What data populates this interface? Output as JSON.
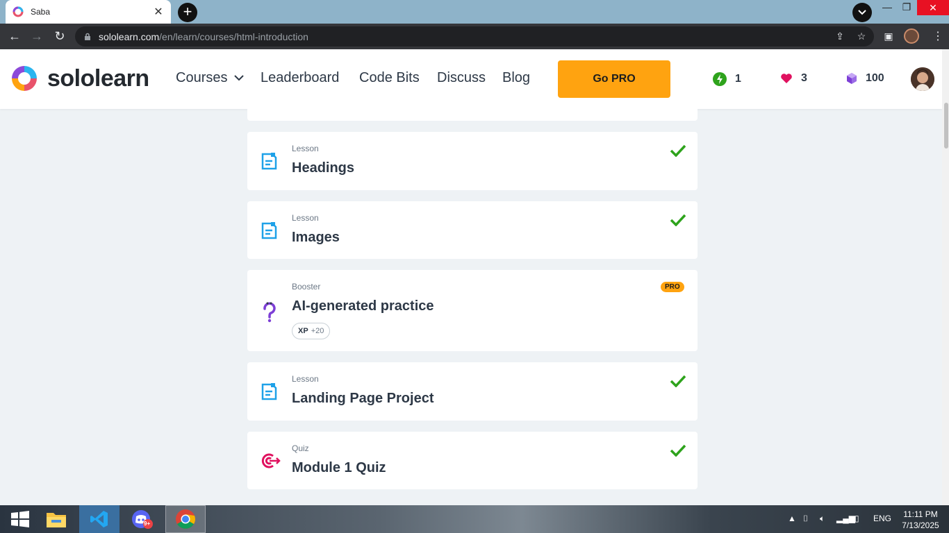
{
  "browser": {
    "tab_title": "Saba",
    "new_tab": "+",
    "url_host": "sololearn.com",
    "url_path": "/en/learn/courses/html-introduction"
  },
  "header": {
    "logo_text": "sololearn",
    "nav": {
      "courses": "Courses",
      "leaderboard": "Leaderboard",
      "code_bits": "Code Bits",
      "discuss": "Discuss",
      "blog": "Blog"
    },
    "go_pro": "Go PRO",
    "streak": "1",
    "hearts": "3",
    "gems": "100"
  },
  "cards": [
    {
      "kind": "Lesson",
      "name": "Headings",
      "icon": "lesson-icon",
      "done": true
    },
    {
      "kind": "Lesson",
      "name": "Images",
      "icon": "lesson-icon",
      "done": true
    },
    {
      "kind": "Booster",
      "name": "AI-generated practice",
      "icon": "question-icon",
      "badge": "PRO",
      "xp_label": "XP",
      "xp_value": "+20"
    },
    {
      "kind": "Lesson",
      "name": "Landing Page Project",
      "icon": "lesson-icon",
      "done": true
    },
    {
      "kind": "Quiz",
      "name": "Module 1 Quiz",
      "icon": "target-icon",
      "done": true
    }
  ],
  "taskbar": {
    "discord_badge": "9+",
    "language": "ENG",
    "time": "11:11 PM",
    "date": "7/13/2025"
  },
  "colors": {
    "accent_orange": "#ffa310",
    "check_green": "#2ea31c",
    "lesson_blue": "#1ea1e8",
    "booster_purple": "#7d3fd6",
    "quiz_pink": "#e0115f"
  }
}
